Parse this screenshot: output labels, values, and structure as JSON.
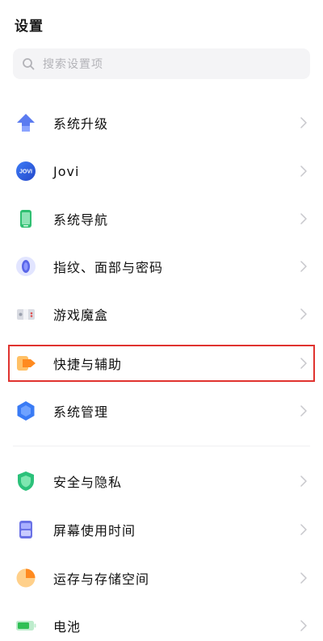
{
  "header": {
    "title": "设置"
  },
  "search": {
    "placeholder": "搜索设置项"
  },
  "items": [
    {
      "label": "系统升级",
      "icon": "upload-arrow-icon"
    },
    {
      "label": "Jovi",
      "icon": "jovi-logo-icon",
      "logo_text": "JOVI"
    },
    {
      "label": "系统导航",
      "icon": "phone-navigation-icon"
    },
    {
      "label": "指纹、面部与密码",
      "icon": "fingerprint-icon"
    },
    {
      "label": "游戏魔盒",
      "icon": "game-box-icon"
    },
    {
      "label": "快捷与辅助",
      "icon": "shortcut-icon"
    },
    {
      "label": "系统管理",
      "icon": "hexagon-icon"
    },
    {
      "label": "安全与隐私",
      "icon": "shield-icon"
    },
    {
      "label": "屏幕使用时间",
      "icon": "hourglass-icon"
    },
    {
      "label": "运存与存储空间",
      "icon": "storage-pie-icon"
    },
    {
      "label": "电池",
      "icon": "battery-icon"
    }
  ],
  "colors": {
    "highlight": "#e0332f",
    "chevron": "#c7c7cc"
  }
}
